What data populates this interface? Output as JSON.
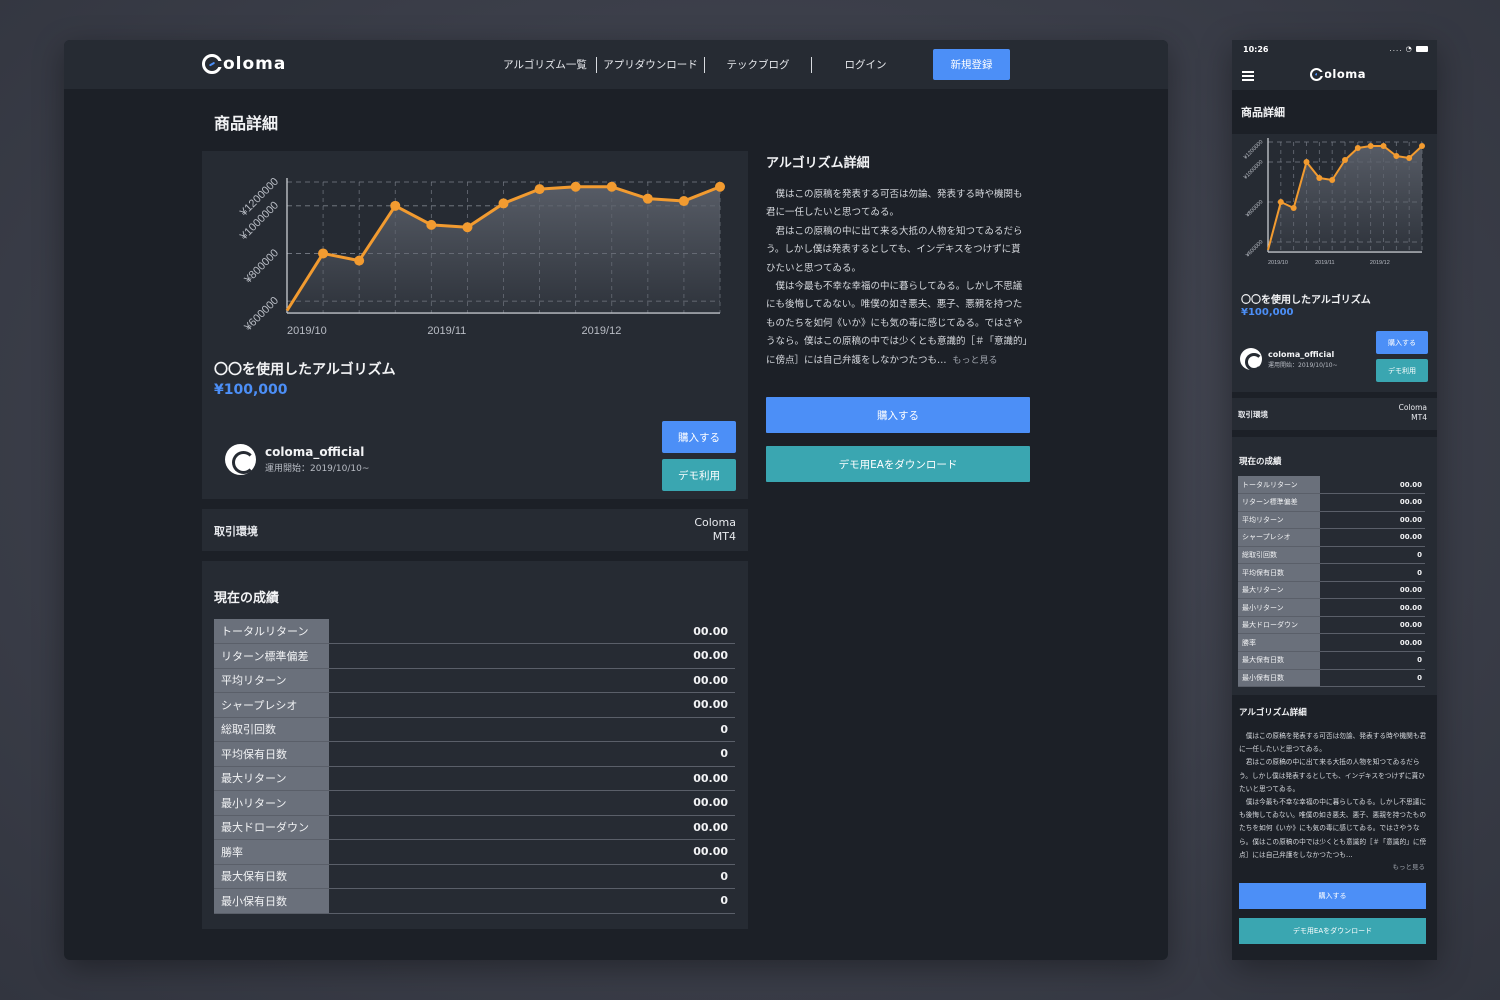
{
  "brand": {
    "name": "oloma"
  },
  "nav": {
    "links": [
      "アルゴリズム一覧",
      "アプリダウンロード",
      "テックブログ",
      "ログイン"
    ],
    "signup": "新規登録"
  },
  "page_title": "商品詳細",
  "chart_data": {
    "type": "area",
    "x": [
      "2019/10/01",
      "2019/10/08",
      "2019/10/15",
      "2019/10/22",
      "2019/10/29",
      "2019/11/05",
      "2019/11/12",
      "2019/11/19",
      "2019/11/26",
      "2019/12/03",
      "2019/12/10",
      "2019/12/17",
      "2019/12/24"
    ],
    "y": [
      560000,
      800000,
      770000,
      1000000,
      920000,
      910000,
      1010000,
      1070000,
      1080000,
      1080000,
      1030000,
      1020000,
      1080000
    ],
    "xticks": [
      "2019/10",
      "2019/11",
      "2019/12"
    ],
    "yticks": [
      "¥600000",
      "¥800000",
      "¥1000000",
      "¥1200000"
    ],
    "ylim": [
      550000,
      1100000
    ],
    "colors": {
      "line": "#f29b30",
      "area": "#5c616b"
    },
    "grid": true
  },
  "product": {
    "name": "〇〇を使用したアルゴリズム",
    "price": "¥100,000",
    "owner": "coloma_official",
    "since": "運用開始：2019/10/10~",
    "buy": "購入する",
    "demo": "デモ利用"
  },
  "environment": {
    "label": "取引環境",
    "value_line1": "Coloma",
    "value_line2": "MT4"
  },
  "performance": {
    "title": "現在の成績",
    "rows": [
      {
        "label": "トータルリターン",
        "value": "00.00"
      },
      {
        "label": "リターン標準偏差",
        "value": "00.00"
      },
      {
        "label": "平均リターン",
        "value": "00.00"
      },
      {
        "label": "シャープレシオ",
        "value": "00.00"
      },
      {
        "label": "総取引回数",
        "value": "0"
      },
      {
        "label": "平均保有日数",
        "value": "0"
      },
      {
        "label": "最大リターン",
        "value": "00.00"
      },
      {
        "label": "最小リターン",
        "value": "00.00"
      },
      {
        "label": "最大ドローダウン",
        "value": "00.00"
      },
      {
        "label": "勝率",
        "value": "00.00"
      },
      {
        "label": "最大保有日数",
        "value": "0"
      },
      {
        "label": "最小保有日数",
        "value": "0"
      }
    ]
  },
  "detail": {
    "title": "アルゴリズム詳細",
    "paragraphs": [
      "僕はこの原稿を発表する可否は勿論、発表する時や機関も君に一任したいと思つてゐる。",
      "君はこの原稿の中に出て来る大抵の人物を知つてゐるだらう。しかし僕は発表するとしても、インデキスをつけずに貰ひたいと思つてゐる。",
      "僕は今最も不幸な幸福の中に暮らしてゐる。しかし不思議にも後悔してゐない。唯僕の如き悪夫、悪子、悪親を持つたものたちを如何《いか》にも気の毒に感じてゐる。ではさやうなら。僕はこの原稿の中では少くとも意識的［＃「意識的」に傍点］には自己弁護をしなかつたつも…"
    ],
    "more": "もっと見る",
    "buy": "購入する",
    "demo_download": "デモ用EAをダウンロード"
  },
  "mobile": {
    "time": "10:26",
    "status": "....",
    "demo": "デモ利用",
    "demo_download": "デモ用EAをダウンロード"
  }
}
